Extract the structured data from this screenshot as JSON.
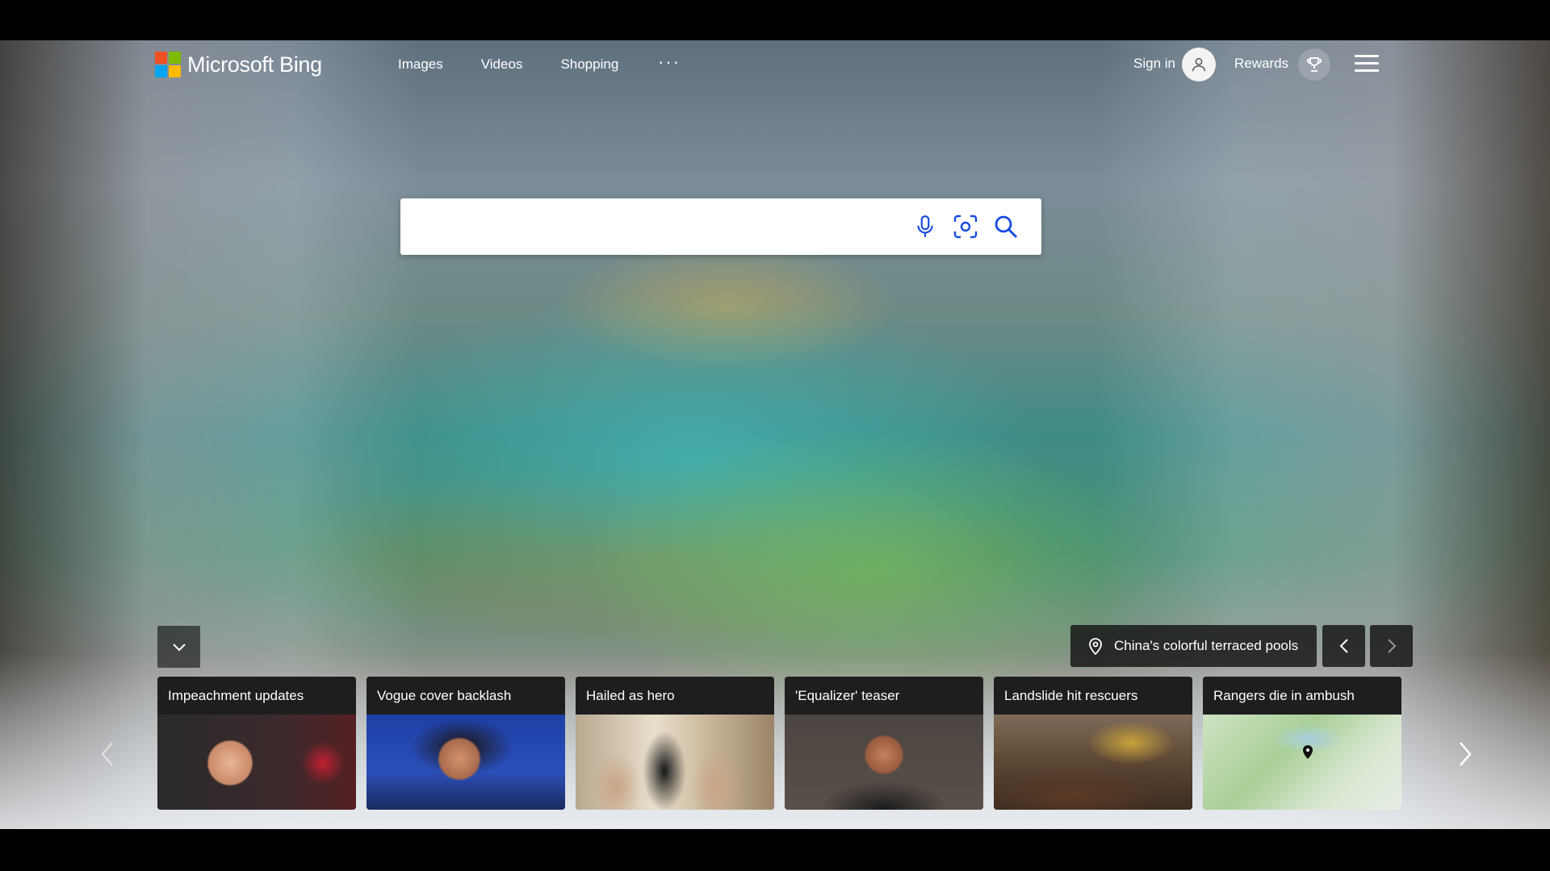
{
  "brand": {
    "name": "Microsoft Bing",
    "logo_colors": [
      "#f25022",
      "#7fba00",
      "#00a4ef",
      "#ffb900"
    ]
  },
  "nav": {
    "items": [
      {
        "label": "Images"
      },
      {
        "label": "Videos"
      },
      {
        "label": "Shopping"
      }
    ],
    "more_label": "···"
  },
  "account": {
    "sign_in_label": "Sign in",
    "rewards_label": "Rewards"
  },
  "search": {
    "value": "",
    "placeholder": "",
    "icons": [
      "microphone-icon",
      "visual-search-icon",
      "search-icon"
    ],
    "icon_color": "#174ae4"
  },
  "image_info": {
    "caption": "China's colorful terraced pools"
  },
  "news_cards": [
    {
      "title": "Impeachment updates"
    },
    {
      "title": "Vogue cover backlash"
    },
    {
      "title": "Hailed as hero"
    },
    {
      "title": "'Equalizer' teaser"
    },
    {
      "title": "Landslide hit rescuers"
    },
    {
      "title": "Rangers die in ambush"
    }
  ]
}
